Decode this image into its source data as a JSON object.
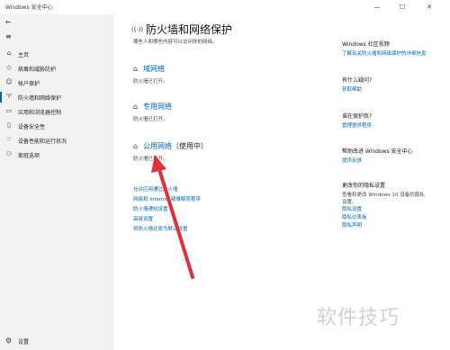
{
  "window": {
    "title": "Windows 安全中心",
    "minimize": "—",
    "maximize": "☐",
    "close": "✕"
  },
  "sidebar": {
    "back_icon": "←",
    "menu_icon": "≡",
    "items": [
      {
        "icon": "⌂",
        "label": "主页"
      },
      {
        "icon": "◇",
        "label": "病毒和威胁防护"
      },
      {
        "icon": "☺",
        "label": "帐户保护"
      },
      {
        "icon": "♈",
        "label": "防火墙和网络保护"
      },
      {
        "icon": "▭",
        "label": "应用和浏览器控制"
      },
      {
        "icon": "▯",
        "label": "设备安全性"
      },
      {
        "icon": "♡",
        "label": "设备性能和运行状况"
      },
      {
        "icon": "⚇",
        "label": "家庭选项"
      }
    ],
    "settings_icon": "⚙",
    "settings_label": "设置"
  },
  "main": {
    "title_icon": "((·))",
    "title": "防火墙和网络保护",
    "description": "哪些人和哪些内容可以访问你的网络。",
    "networks": [
      {
        "icon": "⌂",
        "name": "域网络",
        "suffix": "",
        "status": "防火墙已打开。"
      },
      {
        "icon": "⌂",
        "name": "专用网络",
        "suffix": "",
        "status": "防火墙已打开。"
      },
      {
        "icon": "⌂",
        "name": "公用网络",
        "suffix": "（使用中）",
        "status": "防火墙已打开。"
      }
    ],
    "links": [
      "允许应用通过防火墙",
      "网络和 Internet 疑难解答程序",
      "防火墙通知设置",
      "高级设置",
      "将防火墙还原为默认设置"
    ]
  },
  "right": {
    "sections": [
      {
        "heading": "Windows 社区视频",
        "lines": [],
        "links": [
          "了解有关防火墙和网络保护的详细信息"
        ]
      },
      {
        "heading": "有什么疑问?",
        "lines": [],
        "links": [
          "获取帮助"
        ]
      },
      {
        "heading": "谁在保护我?",
        "lines": [],
        "links": [
          "管理提供程序"
        ]
      },
      {
        "heading": "帮助改进 Windows 安全中心",
        "lines": [],
        "links": [
          "提供反馈"
        ]
      },
      {
        "heading": "更改你的隐私设置",
        "lines": [
          "查看和更改 Windows 10 设备的隐私",
          "设置。"
        ],
        "links": [
          "隐私设置",
          "隐私仪表板",
          "隐私声明"
        ]
      }
    ]
  },
  "watermark": "软件技巧"
}
